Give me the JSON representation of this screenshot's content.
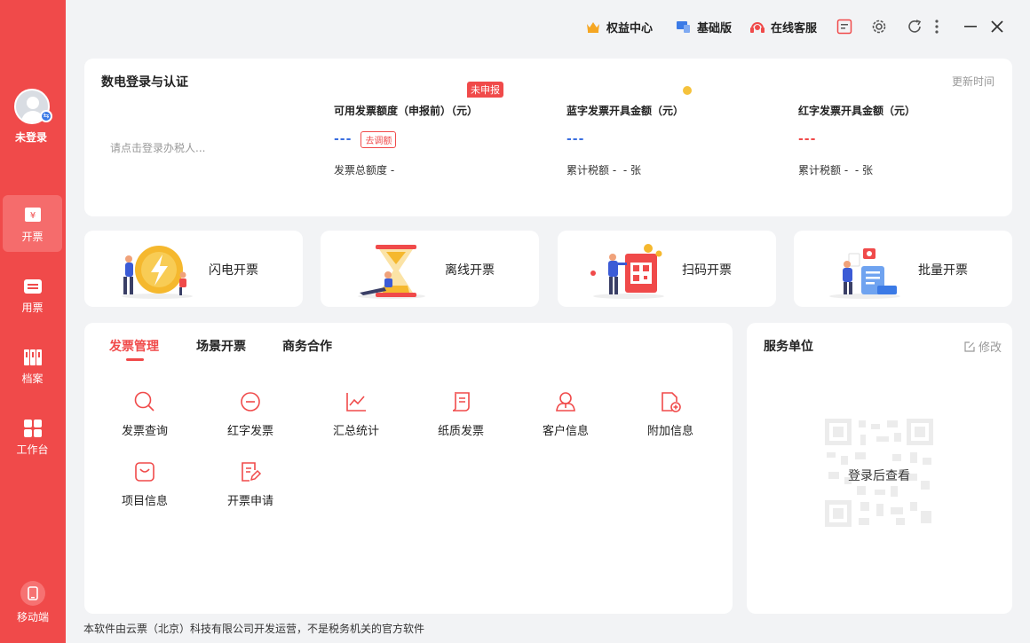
{
  "sidebar": {
    "user_label": "未登录",
    "items": [
      {
        "label": "开票",
        "icon": "invoice-icon"
      },
      {
        "label": "用票",
        "icon": "ticket-icon"
      },
      {
        "label": "档案",
        "icon": "archive-icon"
      },
      {
        "label": "工作台",
        "icon": "workbench-icon"
      }
    ],
    "mobile_label": "移动端"
  },
  "topbar": {
    "rights_label": "权益中心",
    "edition_label": "基础版",
    "support_label": "在线客服"
  },
  "certification": {
    "title": "数电登录与认证",
    "update_label": "更新时间",
    "login_placeholder": "请点击登录办税人...",
    "undeclared_badge": "未申报",
    "available": {
      "title": "可用发票额度（申报前）（元）",
      "value": "---",
      "adjust_label": "去调额",
      "sub_label": "发票总额度",
      "sub_value": "-"
    },
    "blue": {
      "title": "蓝字发票开具金额（元）",
      "value": "---",
      "sub_label": "累计税额",
      "sub_value": "-",
      "sub_unit": "张"
    },
    "red": {
      "title": "红字发票开具金额（元）",
      "value": "---",
      "sub_label": "累计税额",
      "sub_value": "-",
      "sub_unit": "张"
    }
  },
  "quick_actions": [
    {
      "label": "闪电开票"
    },
    {
      "label": "离线开票"
    },
    {
      "label": "扫码开票"
    },
    {
      "label": "批量开票"
    }
  ],
  "management": {
    "tabs": [
      {
        "label": "发票管理",
        "active": true
      },
      {
        "label": "场景开票",
        "active": false
      },
      {
        "label": "商务合作",
        "active": false
      }
    ],
    "functions": [
      {
        "label": "发票查询",
        "icon": "search-icon"
      },
      {
        "label": "红字发票",
        "icon": "minus-circle-icon"
      },
      {
        "label": "汇总统计",
        "icon": "line-chart-icon"
      },
      {
        "label": "纸质发票",
        "icon": "paper-receipt-icon"
      },
      {
        "label": "客户信息",
        "icon": "customer-icon"
      },
      {
        "label": "附加信息",
        "icon": "add-document-icon"
      },
      {
        "label": "项目信息",
        "icon": "bag-icon"
      },
      {
        "label": "开票申请",
        "icon": "edit-document-icon"
      }
    ]
  },
  "service": {
    "title": "服务单位",
    "edit_label": "修改",
    "qr_text": "登录后查看"
  },
  "footer": {
    "text": "本软件由云票（北京）科技有限公司开发运营，不是税务机关的官方软件"
  },
  "colors": {
    "accent": "#f04a4a",
    "blue_value": "#3b6fe0",
    "red_value": "#f04a4a",
    "background": "#f2f3f5"
  }
}
